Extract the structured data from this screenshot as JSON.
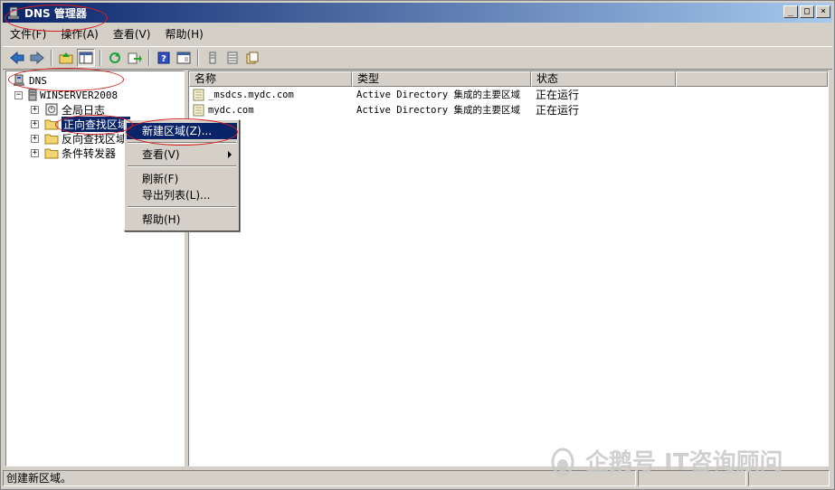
{
  "window": {
    "title": "DNS 管理器",
    "controls": {
      "minimize": "_",
      "maximize": "□",
      "close": "×"
    }
  },
  "menubar": {
    "items": [
      "文件(F)",
      "操作(A)",
      "查看(V)",
      "帮助(H)"
    ]
  },
  "toolbar": {
    "icons": [
      "back-icon",
      "forward-icon",
      "up-icon",
      "show-hide-tree-icon",
      "refresh-icon",
      "export-list-icon",
      "help-icon",
      "properties-icon",
      "list-icon",
      "details-icon",
      "filter-icon"
    ]
  },
  "tree": {
    "root": "DNS",
    "server": "WINSERVER2008",
    "children": [
      "全局日志",
      "正向查找区域",
      "反向查找区域",
      "条件转发器"
    ],
    "selected": "正向查找区域"
  },
  "list": {
    "columns": [
      "名称",
      "类型",
      "状态"
    ],
    "rows": [
      {
        "name": "_msdcs.mydc.com",
        "type": "Active Directory 集成的主要区域",
        "status": "正在运行"
      },
      {
        "name": "mydc.com",
        "type": "Active Directory 集成的主要区域",
        "status": "正在运行"
      }
    ]
  },
  "context_menu": {
    "items": [
      {
        "label": "新建区域(Z)...",
        "highlighted": true
      },
      {
        "label": "查看(V)",
        "submenu": true
      },
      {
        "label": "刷新(F)"
      },
      {
        "label": "导出列表(L)..."
      },
      {
        "label": "帮助(H)"
      }
    ]
  },
  "statusbar": {
    "text": "创建新区域。"
  },
  "watermark": {
    "text": "企鹅号 IT咨询顾问"
  },
  "colors": {
    "title_start": "#0a246a",
    "title_end": "#a6caf0",
    "selection": "#0a246a",
    "annotation": "#d42020",
    "face": "#d4d0c8"
  }
}
